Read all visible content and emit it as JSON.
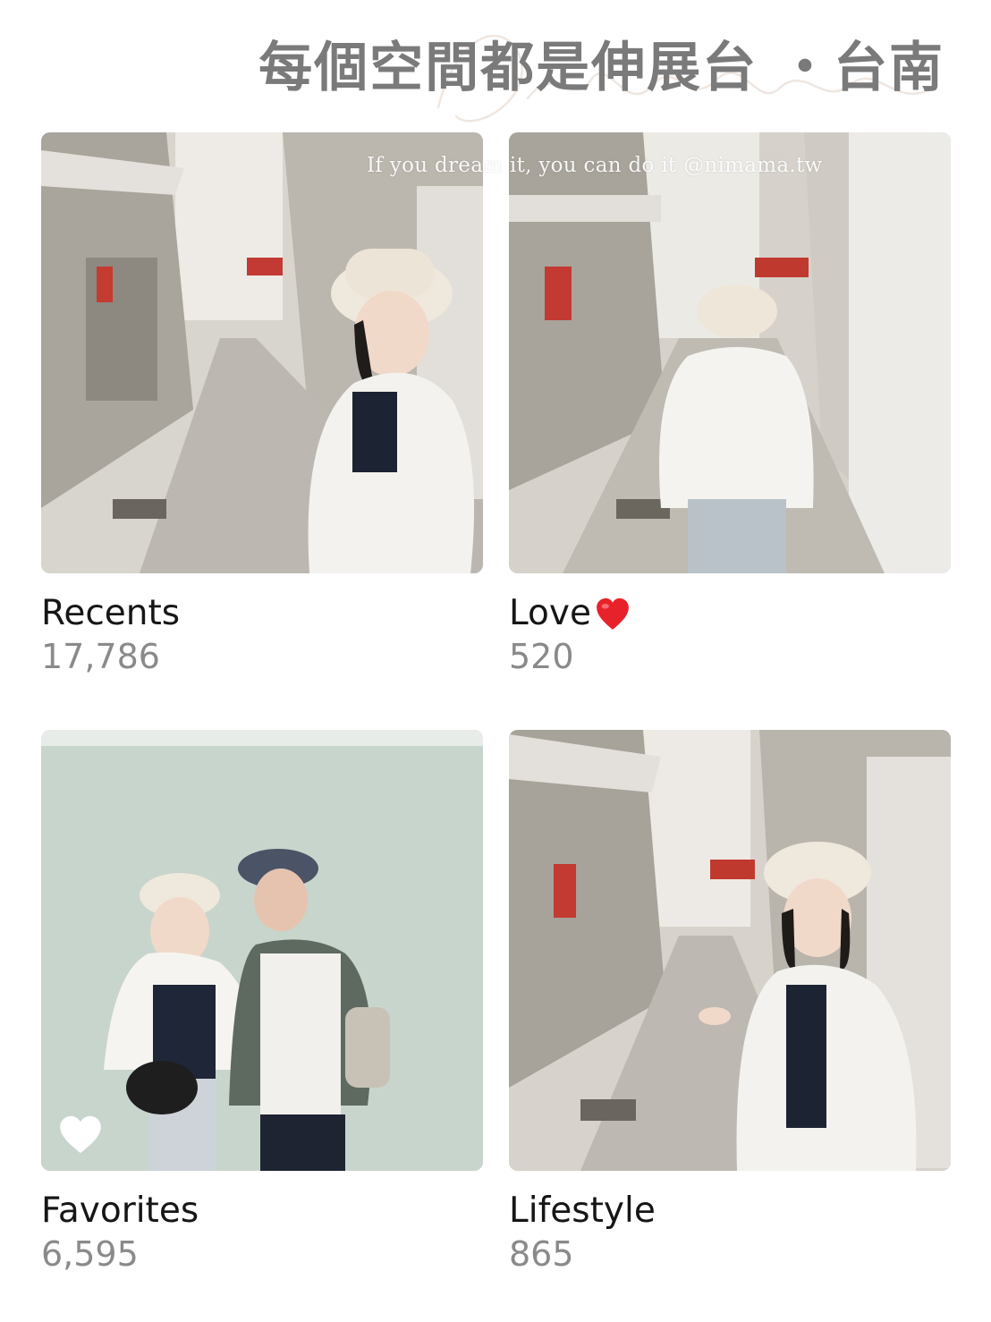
{
  "header": {
    "title": "每個空間都是伸展台 ・台南"
  },
  "overlay": {
    "watermark": "If you dream it, you can do it @nimama.tw"
  },
  "albums": [
    {
      "name": "Recents",
      "count": "17,786"
    },
    {
      "name": "Love",
      "count": "520"
    },
    {
      "name": "Favorites",
      "count": "6,595"
    },
    {
      "name": "Lifestyle",
      "count": "865"
    }
  ],
  "colors": {
    "title": "#7a7a7a",
    "album_name": "#161616",
    "album_count": "#8a8a8a",
    "love_emoji": "#e8222a"
  },
  "icons": {
    "love_badge": "red-heart-emoji",
    "favorite_badge": "heart-icon"
  }
}
